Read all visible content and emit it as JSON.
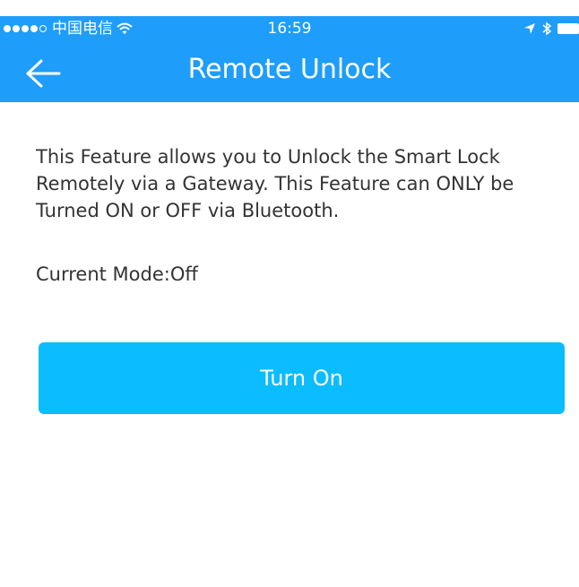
{
  "colors": {
    "header_background": "#1e9dfa",
    "button_background": "#0bbcff",
    "text": "#333333",
    "page_background": "#ffffff"
  },
  "status_bar": {
    "carrier": "中国电信",
    "time": "16:59",
    "icons": [
      "signal-dots-icon",
      "wifi-icon",
      "location-arrow-icon",
      "bluetooth-icon",
      "battery-icon"
    ]
  },
  "nav": {
    "back_icon": "back-arrow-icon",
    "title": "Remote Unlock"
  },
  "content": {
    "description": "This Feature allows you to Unlock the Smart Lock Remotely via a Gateway. This Feature can ONLY be Turned ON or OFF via Bluetooth.",
    "current_mode_label": "Current Mode:",
    "current_mode_value": "Off",
    "turn_on_button": "Turn On"
  }
}
